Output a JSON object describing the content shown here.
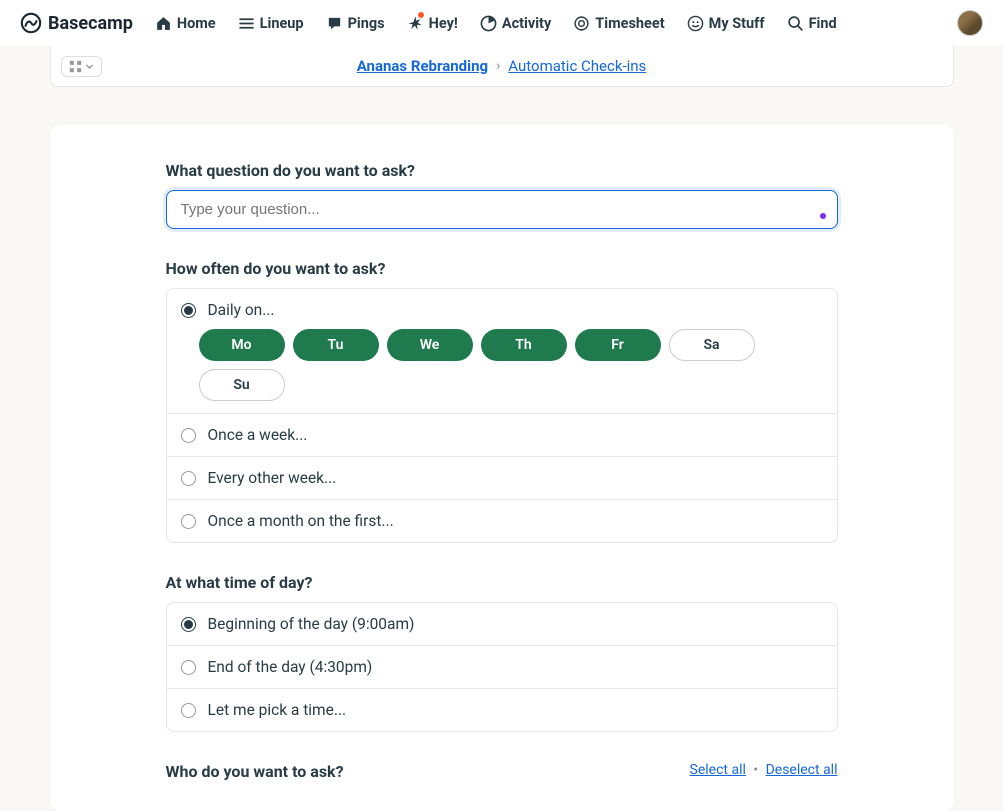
{
  "app_name": "Basecamp",
  "nav": {
    "home": "Home",
    "lineup": "Lineup",
    "pings": "Pings",
    "hey": "Hey!",
    "activity": "Activity",
    "timesheet": "Timesheet",
    "mystuff": "My Stuff",
    "find": "Find"
  },
  "breadcrumb": {
    "project": "Ananas Rebranding",
    "separator": "›",
    "section": "Automatic Check-ins"
  },
  "form": {
    "question_label": "What question do you want to ask?",
    "question_placeholder": "Type your question...",
    "frequency_label": "How often do you want to ask?",
    "frequency": {
      "daily": "Daily on...",
      "weekly": "Once a week...",
      "biweekly": "Every other week...",
      "monthly": "Once a month on the first..."
    },
    "days": {
      "mo": "Mo",
      "tu": "Tu",
      "we": "We",
      "th": "Th",
      "fr": "Fr",
      "sa": "Sa",
      "su": "Su"
    },
    "time_label": "At what time of day?",
    "time": {
      "beginning": "Beginning of the day (9:00am)",
      "end": "End of the day (4:30pm)",
      "pick": "Let me pick a time..."
    },
    "who_label": "Who do you want to ask?",
    "select_all": "Select all",
    "deselect_all": "Deselect all"
  }
}
